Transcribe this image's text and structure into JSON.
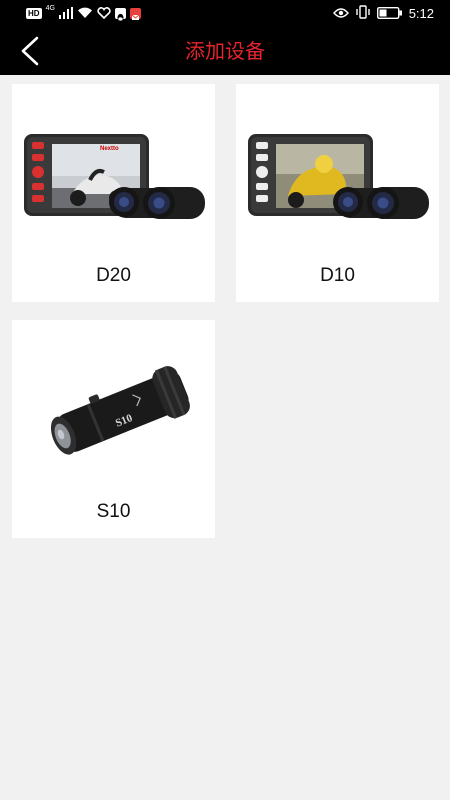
{
  "status_bar": {
    "hd_badge": "HD",
    "network_type": "4G",
    "time": "5:12",
    "icons": [
      "hd-badge",
      "signal-icon",
      "wifi-icon",
      "health-app-icon",
      "qq-app-icon",
      "message-app-icon",
      "eye-icon",
      "vibrate-icon",
      "battery-icon"
    ]
  },
  "header": {
    "title": "添加设备",
    "back_icon": "chevron-left-icon",
    "title_color": "#e5252e",
    "background": "#000000"
  },
  "devices": [
    {
      "name": "D20",
      "image": "dual-lens-dashcam-red-buttons"
    },
    {
      "name": "D10",
      "image": "dual-lens-dashcam-white-buttons"
    },
    {
      "name": "S10",
      "image": "bullet-action-camera"
    }
  ]
}
